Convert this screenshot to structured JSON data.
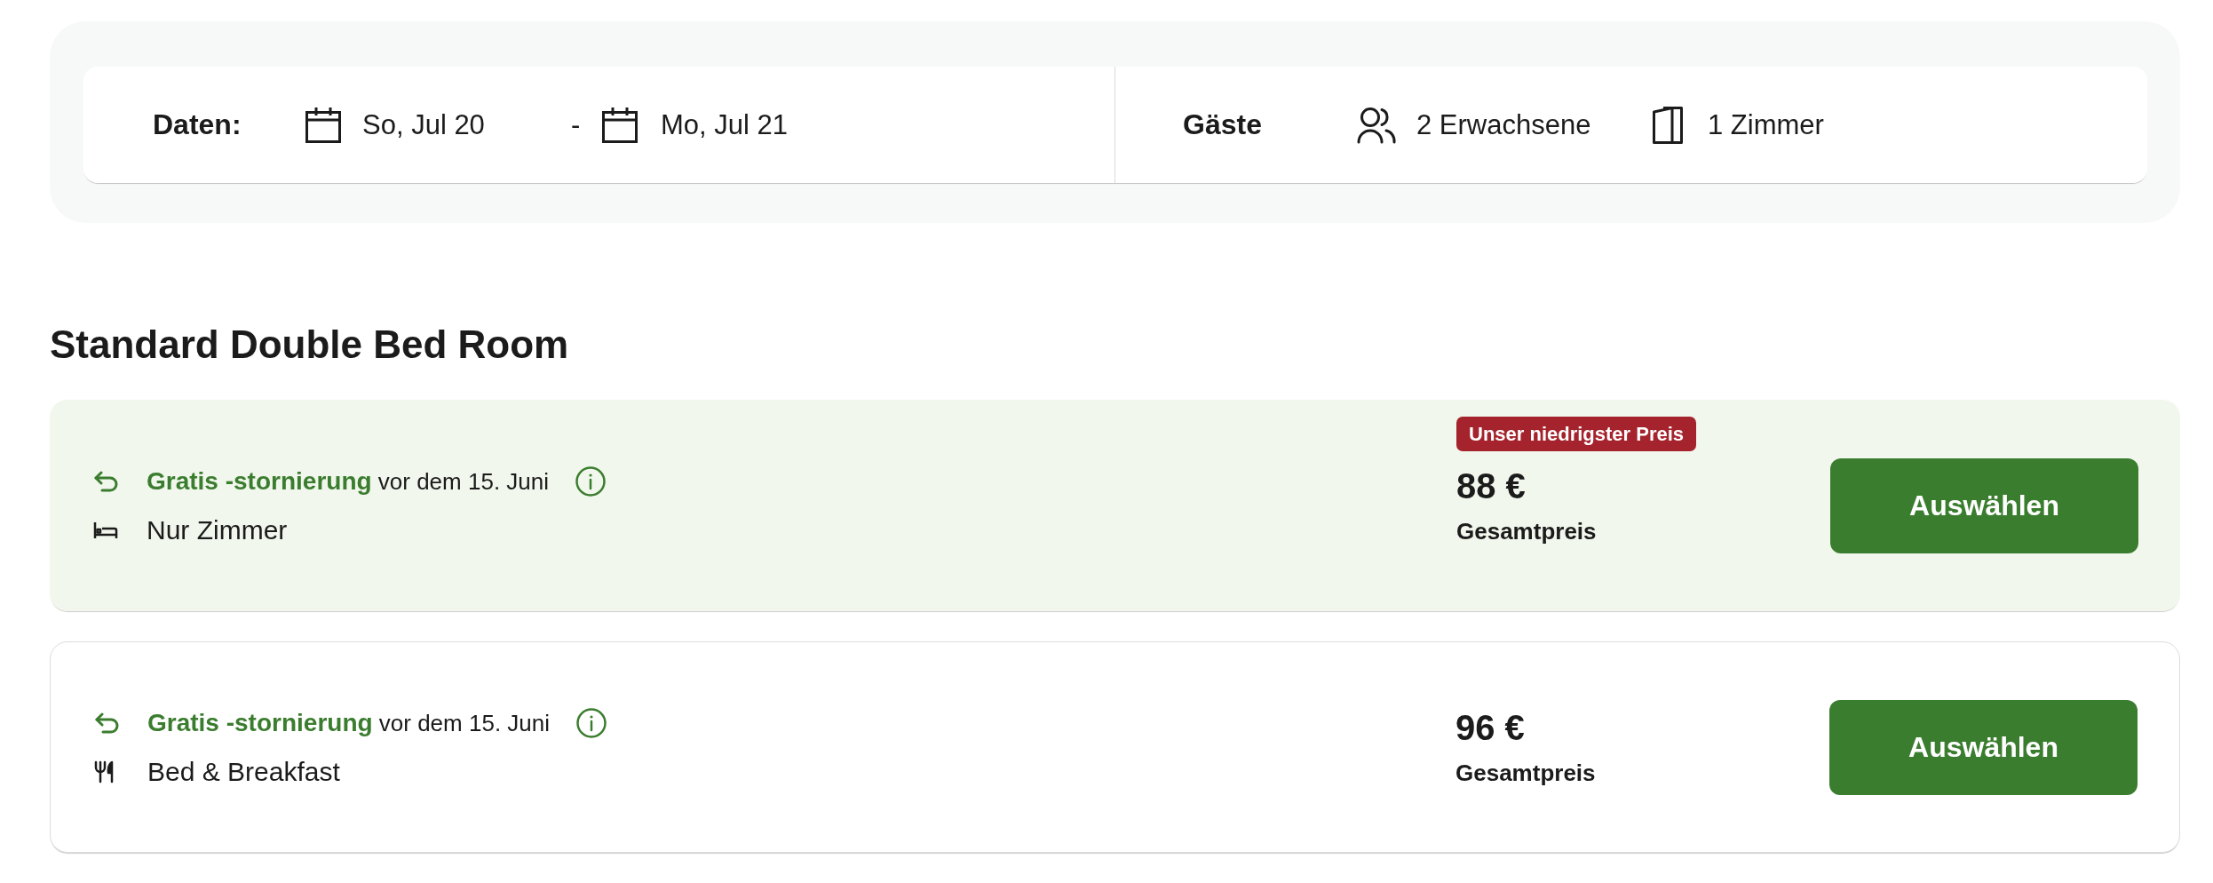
{
  "search_bar": {
    "dates": {
      "label": "Daten:",
      "check_in": "So, Jul 20",
      "separator": "-",
      "check_out": "Mo, Jul 21"
    },
    "guests": {
      "label": "Gäste",
      "adults": "2 Erwachsene",
      "rooms": "1 Zimmer"
    }
  },
  "room": {
    "title": "Standard Double Bed Room",
    "rates": [
      {
        "highlighted": true,
        "cancellation": "**Gratis -stornierung** vor dem 15. Juni",
        "board": {
          "kind": "room_only",
          "label": "Nur Zimmer"
        },
        "badge": "Unser niedrigster Preis",
        "price": "88 €",
        "price_label": "Gesamtpreis",
        "button": "Auswählen"
      },
      {
        "highlighted": false,
        "cancellation": "**Gratis -stornierung** vor dem 15. Juni",
        "board": {
          "kind": "breakfast",
          "label": "Bed & Breakfast"
        },
        "price": "96 €",
        "price_label": "Gesamtpreis",
        "button": "Auswählen"
      }
    ]
  }
}
